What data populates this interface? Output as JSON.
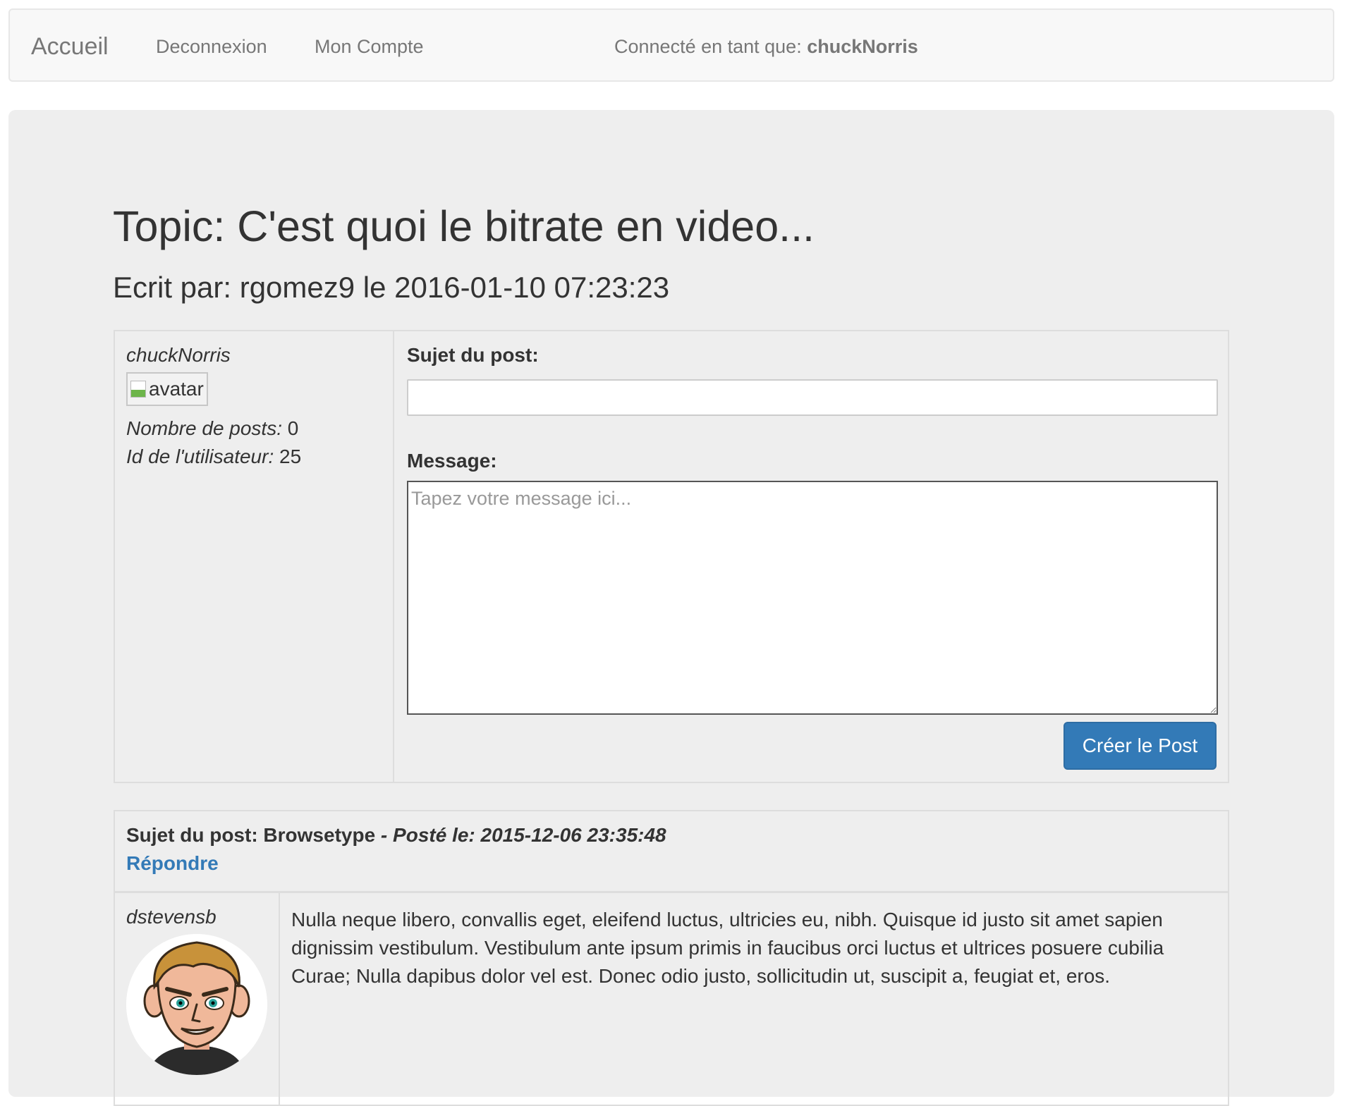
{
  "navbar": {
    "brand": "Accueil",
    "links": [
      "Deconnexion",
      "Mon Compte"
    ],
    "connected_prefix": "Connecté en tant que: ",
    "connected_user": "chuckNorris"
  },
  "topic": {
    "title": "Topic: C'est quoi le bitrate en video...",
    "subtitle": "Ecrit par: rgomez9 le 2016-01-10 07:23:23"
  },
  "compose": {
    "user": {
      "name": "chuckNorris",
      "avatar_alt": "avatar",
      "posts_label": "Nombre de posts:",
      "posts_value": " 0",
      "id_label": "Id de l'utilisateur:",
      "id_value": " 25"
    },
    "subject_label": "Sujet du post:",
    "subject_value": "",
    "message_label": "Message:",
    "message_placeholder": "Tapez votre message ici...",
    "submit_label": "Créer le Post"
  },
  "post": {
    "subject_prefix": "Sujet du post: Browsetype",
    "posted_label": " - Posté le: 2015-12-06 23:35:48",
    "reply_label": "Répondre",
    "author": "dstevensb",
    "text": "Nulla neque libero, convallis eget, eleifend luctus, ultricies eu, nibh. Quisque id justo sit amet sapien dignissim vestibulum. Vestibulum ante ipsum primis in faucibus orci luctus et ultrices posuere cubilia Curae; Nulla dapibus dolor vel est. Donec odio justo, sollicitudin ut, suscipit a, feugiat et, eros."
  },
  "colors": {
    "primary": "#337ab7",
    "jumbotron_bg": "#eeeeee",
    "navbar_bg": "#f8f8f8"
  }
}
